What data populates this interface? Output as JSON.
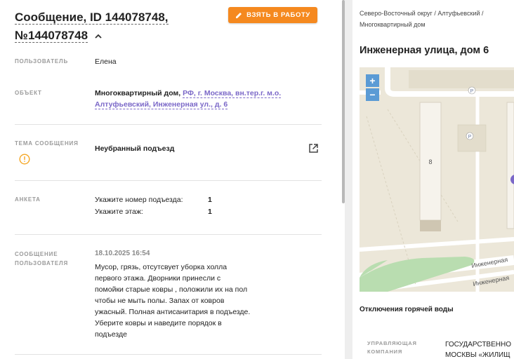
{
  "header": {
    "title_line1": "Сообщение, ID 144078748,",
    "title_line2": "№144078748",
    "take_button": "ВЗЯТЬ В РАБОТУ"
  },
  "fields": {
    "user": {
      "label": "ПОЛЬЗОВАТЕЛЬ",
      "value": "Елена"
    },
    "object": {
      "label": "ОБЪЕКТ",
      "value_prefix": "Многоквартирный дом, ",
      "link_line1": "РФ, г. Москва, вн.тер.г. м.о.",
      "link_line2": "Алтуфьевский, Инженерная ул., д. 6"
    },
    "topic": {
      "label": "ТЕМА СООБЩЕНИЯ",
      "value": "Неубранный подъезд"
    },
    "anketa": {
      "label": "АНКЕТА",
      "rows": [
        {
          "q": "Укажите номер подъезда:",
          "a": "1"
        },
        {
          "q": "Укажите этаж:",
          "a": "1"
        }
      ]
    },
    "message": {
      "label_line1": "СООБЩЕНИЕ",
      "label_line2": "ПОЛЬЗОВАТЕЛЯ",
      "date": "18.10.2025 16:54",
      "lines": [
        "Мусор, грязь, отсутсвует уборка холла",
        "первого этажа. Дворники принесли с",
        "помойки старые ковры , положили их на пол",
        "чтобы не мыть полы. Запах от ковров",
        "ужасный. Полная антисанитария в подъезде.",
        "Уберите ковры и наведите порядок в",
        "подъезде"
      ]
    }
  },
  "right": {
    "breadcrumb_line1": "Северо-Восточный округ / Алтуфьевский /",
    "breadcrumb_line2": "Многоквартирный дом",
    "address": "Инженерная улица, дом 6",
    "map": {
      "zoom_in": "+",
      "zoom_out": "−",
      "building_number": "8",
      "street_label": "Инженерная",
      "parking_label": "P"
    },
    "hot_water": "Отключения горячей воды",
    "uk_label_line1": "УПРАВЛЯЮЩАЯ",
    "uk_label_line2": "КОМПАНИЯ",
    "uk_value_line1": "ГОСУДАРСТВЕННО",
    "uk_value_line2": "МОСКВЫ «ЖИЛИЩ"
  },
  "colors": {
    "accent": "#f5891f",
    "link": "#7b68c8",
    "warning": "#f5a623",
    "map_control": "#5b9bd5"
  }
}
